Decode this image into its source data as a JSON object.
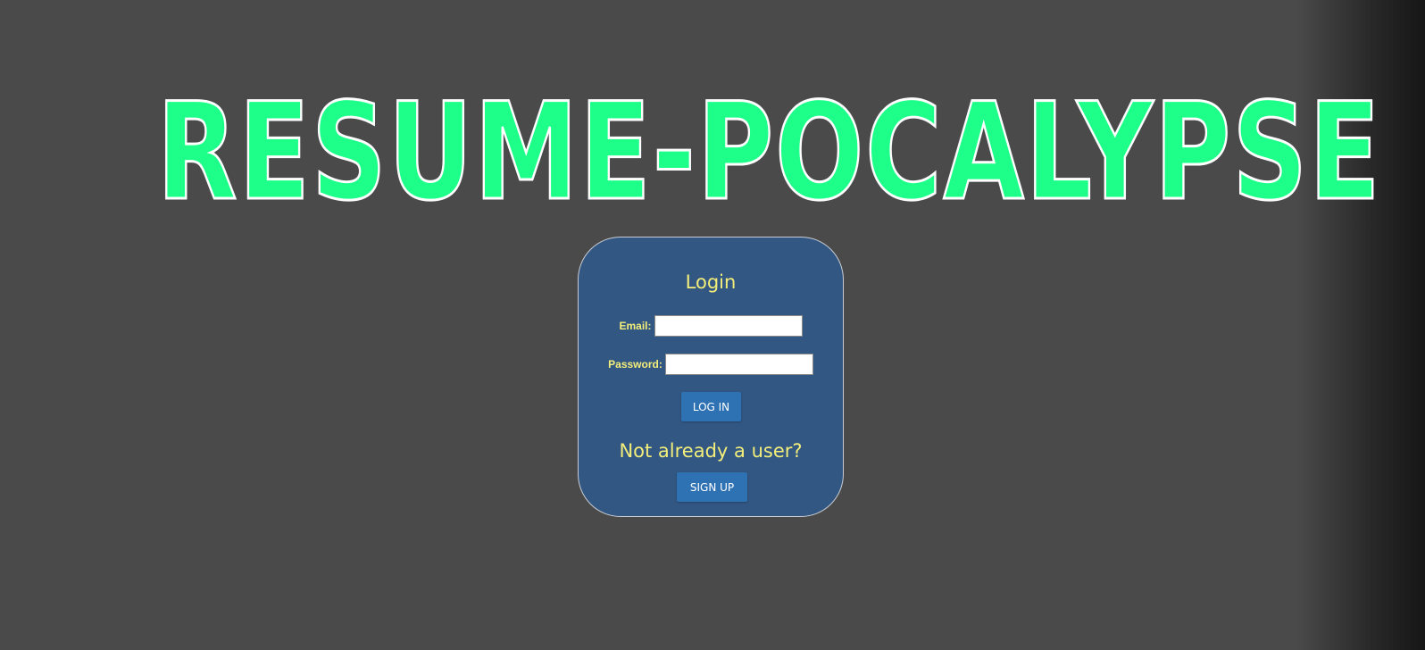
{
  "site": {
    "title": "RESUME-POCALYPSE",
    "title_color": "#1dff88",
    "background_color": "#4a4a4a"
  },
  "login": {
    "heading": "Login",
    "email_label": "Email:",
    "email_value": "",
    "password_label": "Password:",
    "password_value": "",
    "login_button": "LOG IN",
    "signup_prompt": "Not already a user?",
    "signup_button": "SIGN UP",
    "card_color": "#335783",
    "text_color": "#f3ee7a",
    "button_color": "#2f72b4"
  }
}
